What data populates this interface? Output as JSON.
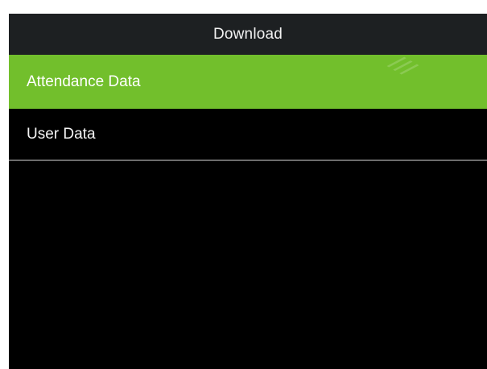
{
  "header": {
    "title": "Download"
  },
  "menu": {
    "items": [
      {
        "label": "Attendance Data",
        "selected": true
      },
      {
        "label": "User Data",
        "selected": false
      }
    ]
  },
  "colors": {
    "title_bar_bg": "#1d2022",
    "screen_bg": "#000000",
    "selected_bg": "#72bf2c",
    "text": "#f5f5f5",
    "divider": "#6c6c6c"
  }
}
